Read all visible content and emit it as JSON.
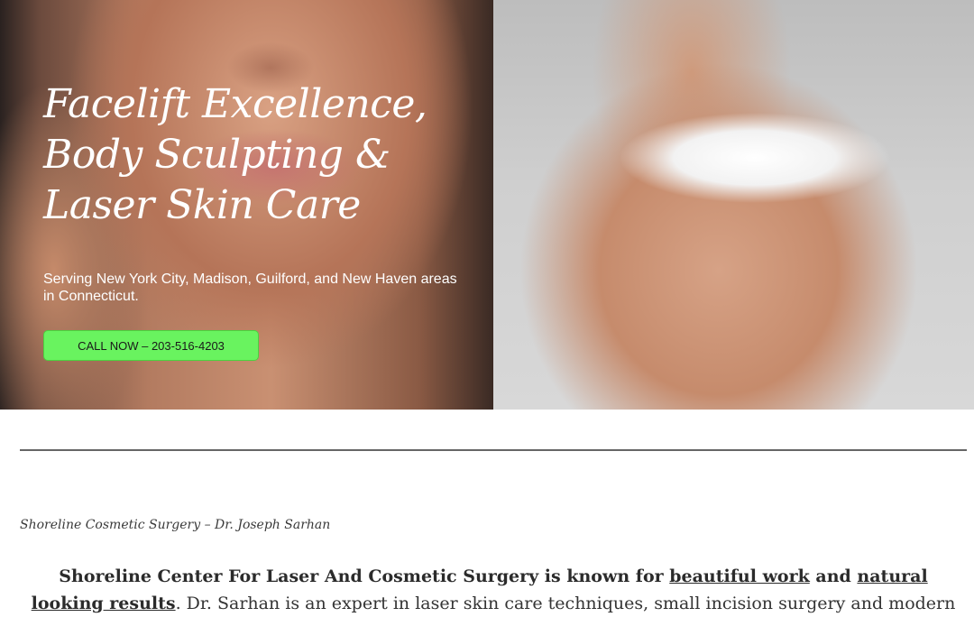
{
  "hero": {
    "headline_lines": [
      "Facelift Excellence,",
      "Body Sculpting &",
      "Laser Skin Care"
    ],
    "subtext": "Serving New York City, Madison, Guilford, and New Haven areas in Connecticut.",
    "call_button_label": "CALL NOW – 203-516-4203"
  },
  "intro": {
    "subtitle": "Shoreline Cosmetic Surgery – Dr. Joseph Sarhan",
    "paragraph": {
      "part1": "Shoreline Center For Laser And Cosmetic Surgery is known for ",
      "link1": "beautiful work",
      "part2": " and ",
      "link2": "natural looking results",
      "part3": ". Dr. Sarhan is an expert in laser skin care techniques, small incision surgery and modern"
    }
  },
  "colors": {
    "call_button": "#69f35f",
    "divider": "#666666",
    "text": "#333333"
  }
}
